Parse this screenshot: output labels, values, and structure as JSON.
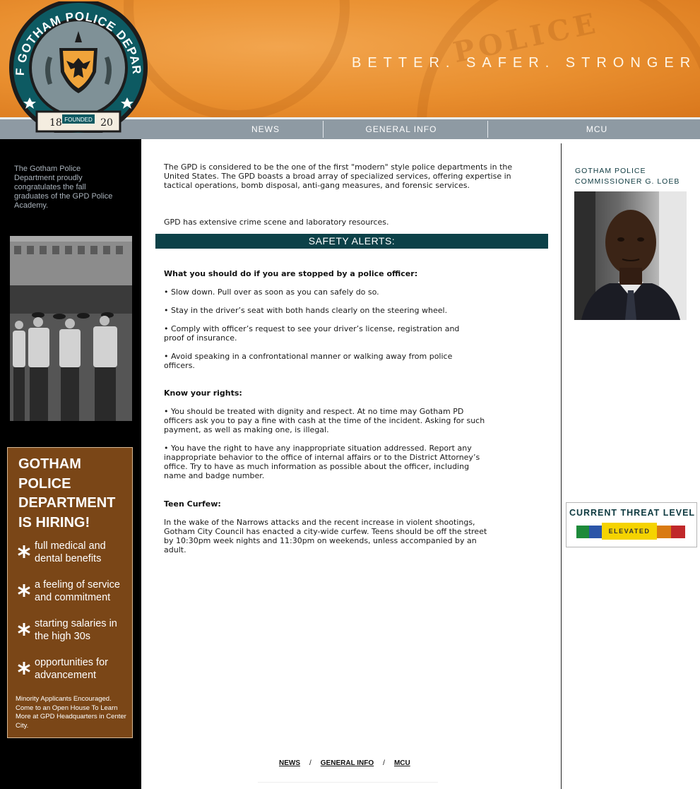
{
  "header": {
    "tagline": "BETTER.  SAFER.  STRONGER",
    "badge": {
      "ring_text": "CITY OF GOTHAM POLICE DEPARTMENT",
      "year_left": "18",
      "year_right": "20",
      "founded": "FOUNDED"
    }
  },
  "nav": {
    "items": [
      {
        "label": "NEWS"
      },
      {
        "label": "GENERAL INFO"
      },
      {
        "label": "MCU"
      }
    ]
  },
  "left": {
    "message": "The Gotham Police Department proudly congratulates the fall graduates of the GPD Police Academy.",
    "hiring": {
      "title": "GOTHAM POLICE DEPARTMENT IS HIRING!",
      "benefits": [
        "full medical and dental benefits",
        "a feeling of service and commitment",
        "starting salaries in the high 30s",
        "opportunities for advancement"
      ],
      "footer": "Minority Applicants Encouraged. Come to an Open House To Learn More at GPD Headquarters in Center City."
    }
  },
  "main": {
    "intro": "The GPD is considered to be the one of the first \"modern\" style police departments in the United States. The GPD boasts a broad array of specialized services, offering expertise in tactical operations, bomb disposal, anti-gang measures, and forensic services.",
    "intro2": "GPD has extensive crime scene and laboratory resources.",
    "alert_title": "SAFETY ALERTS:",
    "stopped": {
      "heading": "What you should do if you are stopped by a police officer:",
      "items": [
        "• Slow down. Pull over as soon as you can safely do so.",
        "• Stay in the driver’s seat with both hands clearly on the steering wheel.",
        "• Comply with officer’s request to see your driver’s license, registration and proof of insurance.",
        "• Avoid speaking in a confrontational manner or walking away from police officers."
      ]
    },
    "rights": {
      "heading": "Know your rights:",
      "items": [
        "• You should be treated with dignity and respect. At no time may Gotham PD officers ask you to pay a fine with cash at the time of the incident. Asking for such payment, as well as making one, is illegal.",
        "• You have the right to have any inappropriate situation addressed. Report any inappropriate behavior to the office of internal affairs or to the District Attorney’s office. Try to have as much information as possible about the officer, including name and badge number."
      ]
    },
    "curfew": {
      "heading": "Teen Curfew:",
      "text": "In the wake of the Narrows attacks and the recent increase in violent shootings, Gotham City Council has enacted a city-wide curfew. Teens should be off the street by 10:30pm week nights and 11:30pm on weekends, unless accompanied by an adult."
    },
    "footer_nav": {
      "news": "NEWS",
      "general_info": "GENERAL INFO",
      "mcu": "MCU",
      "separator": "/"
    }
  },
  "right": {
    "commissioner_label": "GOTHAM POLICE COMMISSIONER G. LOEB",
    "threat": {
      "title": "CURRENT THREAT LEVEL",
      "level": "ELEVATED",
      "colors": [
        "#1d8a3a",
        "#2b55a8",
        "#f5d300",
        "#d97a12",
        "#c0282a"
      ]
    }
  },
  "colors": {
    "header_orange": "#e98f2f",
    "nav_gray": "#8e9aa3",
    "alert_teal": "#0c4148",
    "hiring_brown": "#7a4617"
  }
}
